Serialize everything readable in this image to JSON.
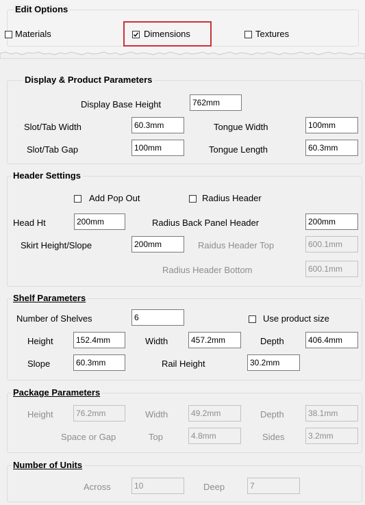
{
  "edit_options": {
    "title": "Edit Options",
    "materials": {
      "label": "Materials",
      "checked": false
    },
    "dimensions": {
      "label": "Dimensions",
      "checked": true
    },
    "textures": {
      "label": "Textures",
      "checked": false
    }
  },
  "display_product": {
    "title": "Display & Product Parameters",
    "display_base_height": {
      "label": "Display Base Height",
      "value": "762mm"
    },
    "slot_tab_width": {
      "label": "Slot/Tab Width",
      "value": "60.3mm"
    },
    "tongue_width": {
      "label": "Tongue Width",
      "value": "100mm"
    },
    "slot_tab_gap": {
      "label": "Slot/Tab Gap",
      "value": "100mm"
    },
    "tongue_length": {
      "label": "Tongue Length",
      "value": "60.3mm"
    }
  },
  "header_settings": {
    "title": "Header Settings",
    "add_pop_out": {
      "label": "Add Pop Out",
      "checked": false
    },
    "radius_header": {
      "label": "Radius Header",
      "checked": false
    },
    "head_ht": {
      "label": "Head Ht",
      "value": "200mm"
    },
    "radius_back_panel_header": {
      "label": "Radius Back Panel Header",
      "value": "200mm"
    },
    "skirt_height_slope": {
      "label": "Skirt Height/Slope",
      "value": "200mm"
    },
    "radius_header_top": {
      "label": "Raidus Header Top",
      "value": "600.1mm"
    },
    "radius_header_bottom": {
      "label": "Radius Header Bottom",
      "value": "600.1mm"
    }
  },
  "shelf_parameters": {
    "title": "Shelf Parameters",
    "number_of_shelves": {
      "label": "Number of Shelves",
      "value": "6"
    },
    "use_product_size": {
      "label": "Use product size",
      "checked": false
    },
    "height": {
      "label": "Height",
      "value": "152.4mm"
    },
    "width": {
      "label": "Width",
      "value": "457.2mm"
    },
    "depth": {
      "label": "Depth",
      "value": "406.4mm"
    },
    "slope": {
      "label": "Slope",
      "value": "60.3mm"
    },
    "rail_height": {
      "label": "Rail Height",
      "value": "30.2mm"
    }
  },
  "package_parameters": {
    "title": "Package Parameters",
    "height": {
      "label": "Height",
      "value": "76.2mm"
    },
    "width": {
      "label": "Width",
      "value": "49.2mm"
    },
    "depth": {
      "label": "Depth",
      "value": "38.1mm"
    },
    "space_or_gap": {
      "label": "Space or Gap"
    },
    "top": {
      "label": "Top",
      "value": "4.8mm"
    },
    "sides": {
      "label": "Sides",
      "value": "3.2mm"
    }
  },
  "number_of_units": {
    "title": "Number of Units",
    "across": {
      "label": "Across",
      "value": "10"
    },
    "deep": {
      "label": "Deep",
      "value": "7"
    }
  },
  "colors": {
    "highlight": "#c8323a",
    "disabled_text": "#8d8d8d",
    "panel_bg": "#f0f0f0"
  }
}
